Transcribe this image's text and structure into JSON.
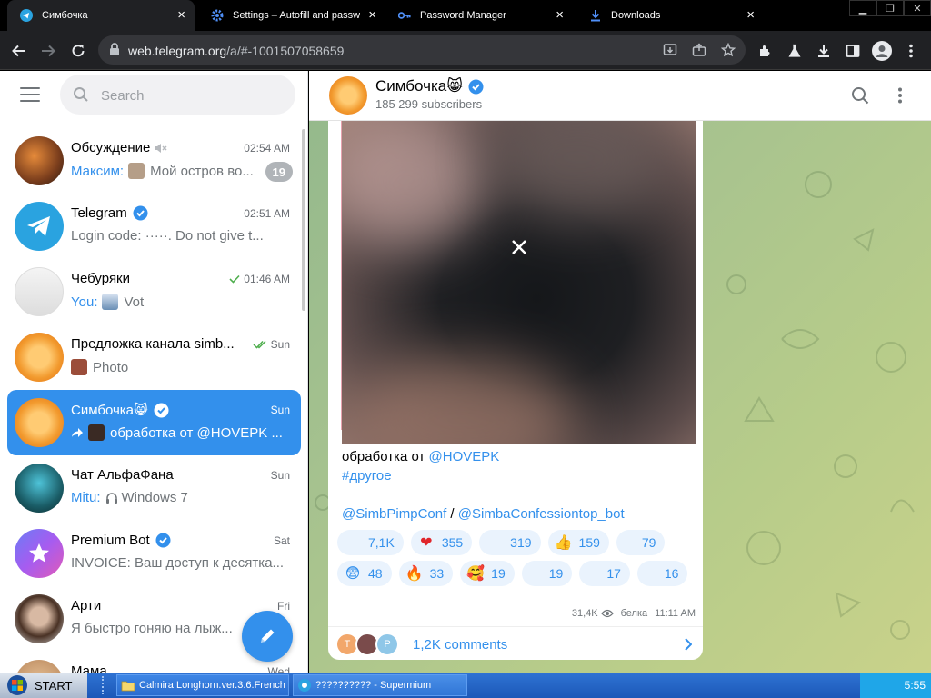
{
  "browser": {
    "tabs": [
      {
        "title": "Симбочка",
        "icon": "telegram-icon",
        "active": true
      },
      {
        "title": "Settings – Autofill and passw",
        "icon": "gear-icon",
        "active": false
      },
      {
        "title": "Password Manager",
        "icon": "key-icon",
        "active": false
      },
      {
        "title": "Downloads",
        "icon": "download-icon",
        "active": false
      }
    ],
    "url_host": "web.telegram.org",
    "url_path": "/a/#-1001507058659"
  },
  "sidebar": {
    "search_placeholder": "Search",
    "chats": [
      {
        "title": "Обсуждение",
        "time": "02:54 AM",
        "sender": "Максим:",
        "preview": "Мой остров во...",
        "unread": "19",
        "muted": true
      },
      {
        "title": "Telegram",
        "time": "02:51 AM",
        "sender": "",
        "preview": "Login code: ·····. Do not give t...",
        "verified": true
      },
      {
        "title": "Чебуряки",
        "time": "01:46 AM",
        "sender": "You:",
        "preview": "Vot",
        "read": true
      },
      {
        "title": "Предложка канала simb...",
        "time": "Sun",
        "sender": "",
        "preview": "Photo",
        "read": true
      },
      {
        "title": "Симбочка😸",
        "time": "Sun",
        "sender": "",
        "preview": "обработка от @HOVEPK ...",
        "verified": true,
        "selected": true
      },
      {
        "title": "Чат АльфаФана",
        "time": "Sun",
        "sender": "Mitu:",
        "preview": "Windows 7"
      },
      {
        "title": "Premium Bot",
        "time": "Sat",
        "sender": "",
        "preview": "INVOICE: Ваш доступ к десятка...",
        "verified": true
      },
      {
        "title": "Арти",
        "time": "Fri",
        "sender": "",
        "preview": "Я быстро гоняю на лыж..."
      },
      {
        "title": "Мама",
        "time": "Wed",
        "sender": "",
        "preview": ""
      }
    ]
  },
  "channel": {
    "title": "Симбочка😸",
    "subtitle": "185 299 subscribers",
    "post": {
      "line1_prefix": "обработка от ",
      "line1_link": "@HOVEPK",
      "hashtag": "#другое",
      "link1": "@SimbPimpConf",
      "separator": " / ",
      "link2": "@SimbaConfessiontop_bot",
      "reactions_row1": [
        {
          "emoji": "",
          "count": "7,1K"
        },
        {
          "emoji": "❤",
          "count": "355"
        },
        {
          "emoji": "",
          "count": "319"
        },
        {
          "emoji": "👍",
          "count": "159"
        },
        {
          "emoji": "",
          "count": "79"
        }
      ],
      "reactions_row2": [
        {
          "emoji": "😨",
          "count": "48"
        },
        {
          "emoji": "🔥",
          "count": "33"
        },
        {
          "emoji": "🥰",
          "count": "19"
        },
        {
          "emoji": "",
          "count": "19"
        },
        {
          "emoji": "",
          "count": "17"
        },
        {
          "emoji": "",
          "count": "16"
        }
      ],
      "views": "31,4K",
      "author": "белка",
      "time": "11:11 AM",
      "comments": "1,2K comments",
      "commenter_initials": [
        "T",
        "",
        "P"
      ]
    }
  },
  "taskbar": {
    "start_label": "START",
    "items": [
      "Calmira Longhorn.ver.3.6.French",
      "?????????? - Supermium"
    ],
    "clock": "5:55"
  },
  "colors": {
    "accent": "#3390ec",
    "selected_chat": "#3390ec",
    "taskbar": "#1c58b8"
  }
}
